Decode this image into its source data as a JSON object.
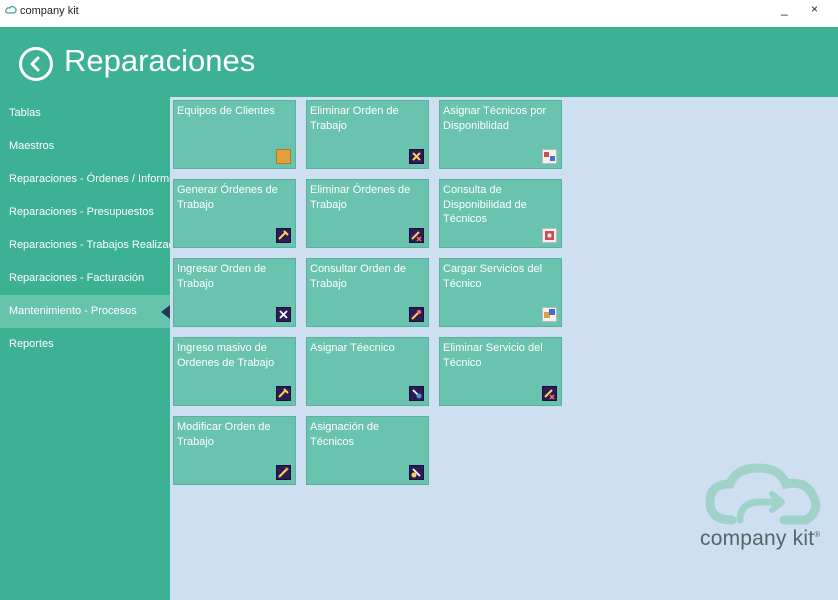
{
  "window": {
    "title": "company kit",
    "controls": "_ ×"
  },
  "header": {
    "title": "Reparaciones"
  },
  "sidebar": {
    "items": [
      {
        "label": "Tablas"
      },
      {
        "label": "Maestros"
      },
      {
        "label": "Reparaciones - Órdenes / Informe"
      },
      {
        "label": "Reparaciones - Presupuestos"
      },
      {
        "label": "Reparaciones - Trabajos Realizados"
      },
      {
        "label": "Reparaciones - Facturación"
      },
      {
        "label": "Mantenimiento - Procesos",
        "selected": true
      },
      {
        "label": "Reportes"
      }
    ]
  },
  "tiles": [
    {
      "label": "Equipos de Clientes",
      "icon": "equipment-icon"
    },
    {
      "label": "Eliminar Orden de Trabajo",
      "icon": "delete-order-icon"
    },
    {
      "label": "Asignar Técnicos por Disponiblidad",
      "icon": "assign-technicians-icon"
    },
    {
      "label": "Generar Órdenes de Trabajo",
      "icon": "generate-orders-icon"
    },
    {
      "label": "Eliminar Órdenes de Trabajo",
      "icon": "delete-orders-icon"
    },
    {
      "label": "Consulta de Disponibilidad de Técnicos",
      "icon": "availability-icon"
    },
    {
      "label": "Ingresar Orden de Trabajo",
      "icon": "enter-order-icon"
    },
    {
      "label": "Consultar Orden de Trabajo",
      "icon": "query-order-icon"
    },
    {
      "label": "Cargar Servicios del Técnico",
      "icon": "load-services-icon"
    },
    {
      "label": "Ingreso masivo de Ordenes de Trabajo",
      "icon": "bulk-entry-icon"
    },
    {
      "label": "Asignar Téecnico",
      "icon": "assign-technician-icon"
    },
    {
      "label": "Eliminar Servicio del Técnico",
      "icon": "delete-service-icon"
    },
    {
      "label": "Modificar Orden de Trabajo",
      "icon": "modify-order-icon"
    },
    {
      "label": "Asignación de Técnicos",
      "icon": "technician-assignment-icon"
    }
  ],
  "logo": {
    "text": "company kit",
    "mark": "®"
  },
  "colors": {
    "accent_green": "#3db193",
    "tile_green": "#69c3ae",
    "content_bg": "#cfdff2",
    "icon_bg": "#2c1b56"
  }
}
